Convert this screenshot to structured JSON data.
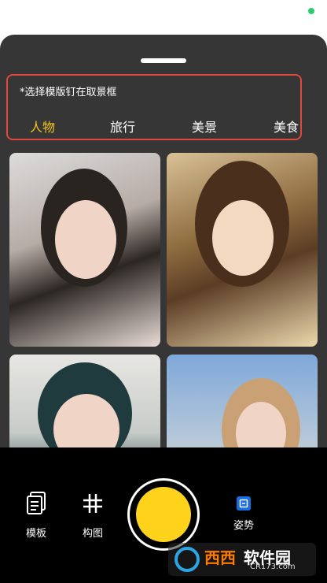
{
  "template_panel": {
    "hint": "*选择模版钉在取景框",
    "tabs": [
      {
        "label": "人物",
        "active": true
      },
      {
        "label": "旅行",
        "active": false
      },
      {
        "label": "美景",
        "active": false
      },
      {
        "label": "美食",
        "active": false
      }
    ]
  },
  "photos": [
    {
      "name": "portrait-photo-1"
    },
    {
      "name": "portrait-photo-2"
    },
    {
      "name": "portrait-photo-3"
    },
    {
      "name": "portrait-photo-4"
    }
  ],
  "toolbar": {
    "template_label": "模板",
    "composition_label": "构图",
    "pose_label": "姿势"
  },
  "watermark": {
    "brand": "西西",
    "name": "软件园",
    "url": "CR173.com"
  },
  "colors": {
    "accent": "#f5c518",
    "shutter": "#ffd21c",
    "highlight_border": "#e0483b",
    "panel": "#363636"
  }
}
